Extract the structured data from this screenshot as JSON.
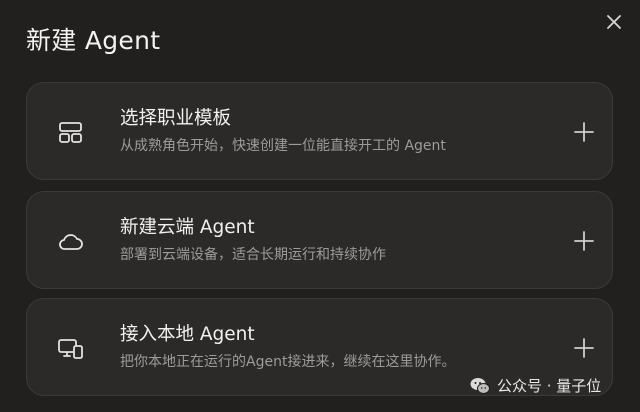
{
  "dialog": {
    "title": "新建 Agent",
    "close_icon": "close-icon"
  },
  "options": [
    {
      "icon": "layout-template-icon",
      "title": "选择职业模板",
      "description": "从成熟角色开始，快速创建一位能直接开工的 Agent",
      "action_icon": "plus-icon"
    },
    {
      "icon": "cloud-icon",
      "title": "新建云端 Agent",
      "description": "部署到云端设备，适合长期运行和持续协作",
      "action_icon": "plus-icon"
    },
    {
      "icon": "local-device-icon",
      "title": "接入本地 Agent",
      "description": "把你本地正在运行的Agent接进来，继续在这里协作。",
      "action_icon": "plus-icon"
    }
  ],
  "watermark": {
    "icon": "wechat-icon",
    "text": "公众号 · 量子位"
  },
  "colors": {
    "background": "#21201e",
    "card": "#2b2a28",
    "card_border": "#3b3a38",
    "title_text": "#f2f2f0",
    "secondary_text": "#9e9c99"
  }
}
